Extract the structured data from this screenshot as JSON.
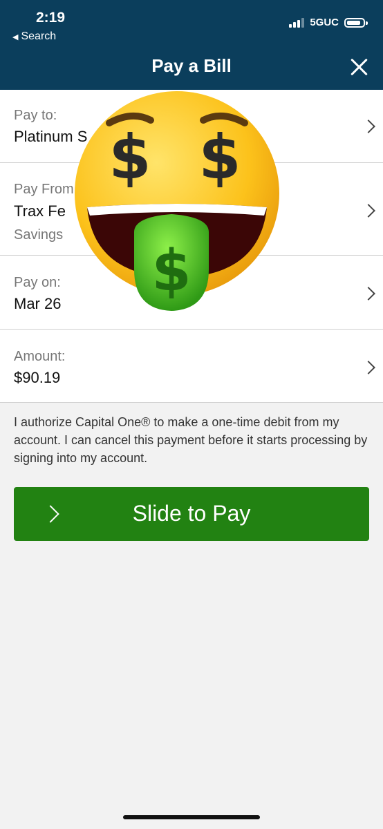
{
  "status": {
    "time": "2:19",
    "back_label": "Search",
    "network": "5GUC"
  },
  "header": {
    "title": "Pay a Bill"
  },
  "rows": [
    {
      "label": "Pay to:",
      "value": "Platinum S"
    },
    {
      "label": "Pay From",
      "value": "Trax Fe",
      "sub": "Savings"
    },
    {
      "label": "Pay on:",
      "value": "Mar 26"
    },
    {
      "label": "Amount:",
      "value": "$90.19"
    }
  ],
  "authorization": "I authorize Capital One® to make a one-time debit from my account. I can cancel this payment before it starts processing by signing into my account.",
  "slide": {
    "label": "Slide to Pay"
  },
  "colors": {
    "header": "#0b3e5c",
    "button": "#228212",
    "background": "#f2f2f2"
  },
  "overlay": {
    "icon": "money-mouth-face-icon"
  }
}
